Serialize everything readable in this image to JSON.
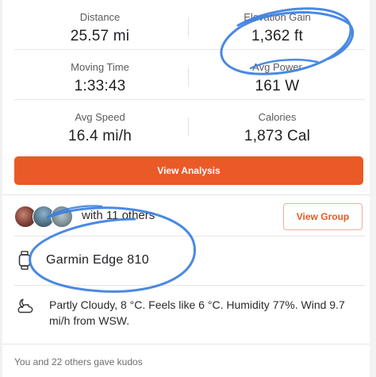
{
  "stats": [
    {
      "label": "Distance",
      "value": "25.57 mi"
    },
    {
      "label": "Elevation Gain",
      "value": "1,362 ft"
    },
    {
      "label": "Moving Time",
      "value": "1:33:43"
    },
    {
      "label": "Avg Power",
      "value": "161 W"
    },
    {
      "label": "Avg Speed",
      "value": "16.4 mi/h"
    },
    {
      "label": "Calories",
      "value": "1,873 Cal"
    }
  ],
  "actions": {
    "view_analysis_label": "View Analysis",
    "view_group_label": "View Group"
  },
  "group": {
    "text": "with 11 others",
    "avatars": [
      "avatar-1",
      "avatar-2",
      "avatar-3"
    ]
  },
  "device": {
    "icon": "watch-icon",
    "name": "Garmin Edge 810"
  },
  "weather": {
    "icon": "weather-cloud-moon-icon",
    "text": "Partly Cloudy, 8 °C. Feels like 6 °C. Humidity 77%. Wind 9.7 mi/h from WSW."
  },
  "kudos": {
    "text": "You and 22 others gave kudos"
  },
  "colors": {
    "accent": "#ea5a27",
    "annotation_ink": "#3b7fe0",
    "text_primary": "#1f1f23",
    "text_secondary": "#5b5b60"
  }
}
